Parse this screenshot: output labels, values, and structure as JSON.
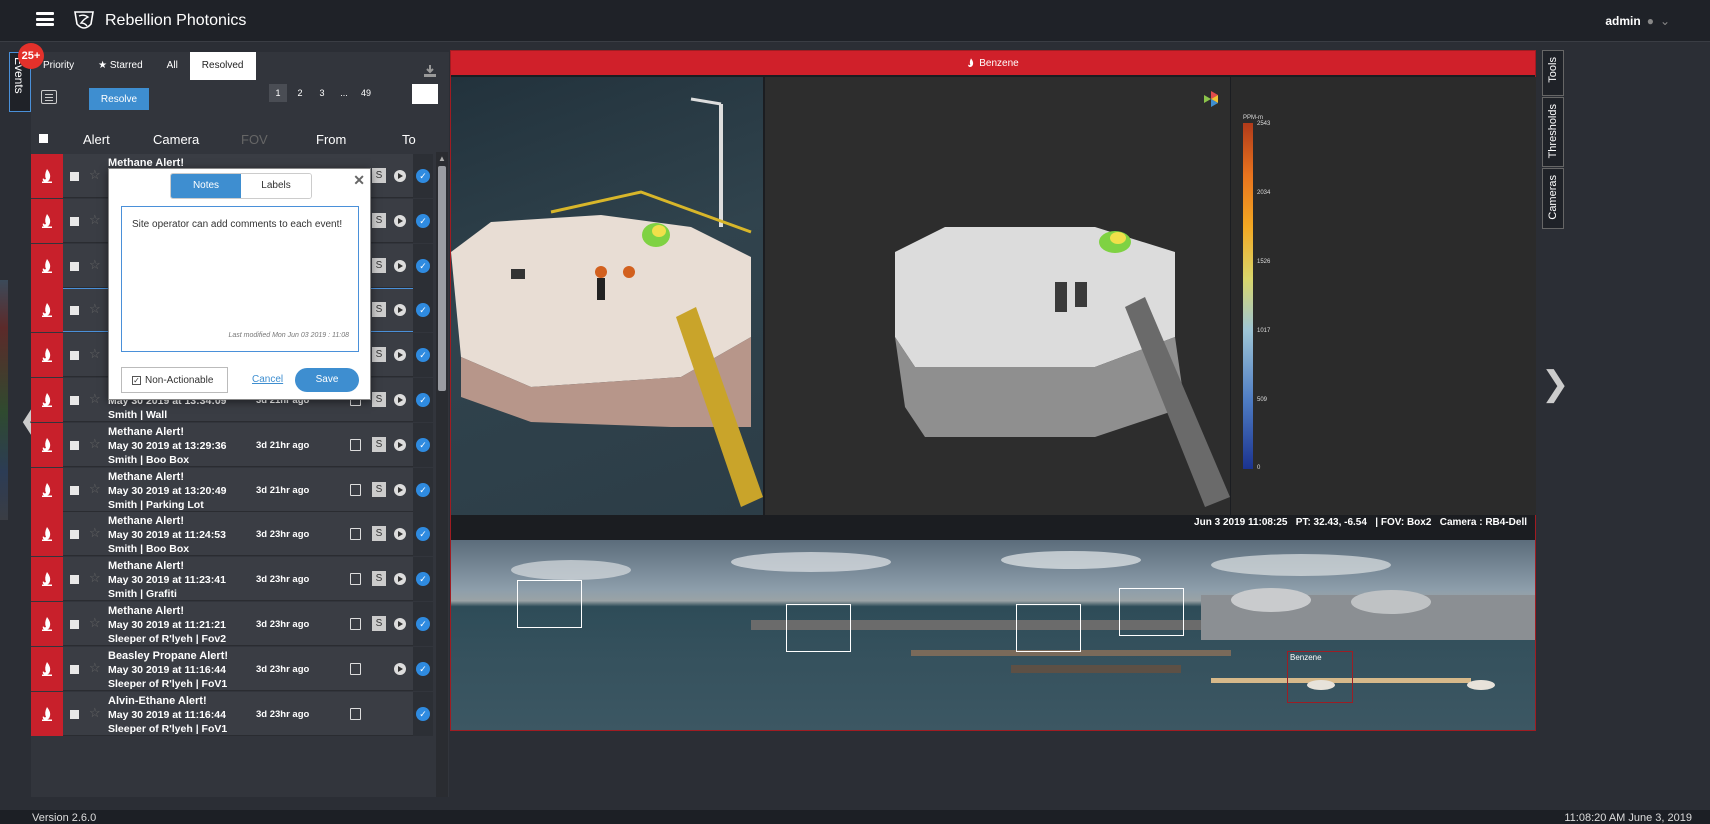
{
  "header": {
    "app_title": "Rebellion Photonics",
    "user": "admin"
  },
  "sidebar": {
    "events_label": "Events",
    "events_badge": "25+"
  },
  "filters": {
    "tabs": [
      "Priority",
      "Starred",
      "All",
      "Resolved"
    ],
    "active_tab": "Resolved"
  },
  "toolbar": {
    "resolve_label": "Resolve"
  },
  "pager": {
    "pages": [
      "1",
      "2",
      "3",
      "...",
      "49"
    ],
    "active_page": "1"
  },
  "list_header": {
    "alert": "Alert",
    "camera": "Camera",
    "fov": "FOV",
    "from": "From",
    "to": "To"
  },
  "events": [
    {
      "title": "Methane Alert!",
      "datetime": "",
      "location": "",
      "ago": "",
      "starred": false,
      "selected": false
    },
    {
      "title": "",
      "datetime": "",
      "location": "",
      "ago": ""
    },
    {
      "title": "",
      "datetime": "",
      "location": "",
      "ago": ""
    },
    {
      "title": "",
      "datetime": "",
      "location": "",
      "ago": "",
      "selected": true
    },
    {
      "title": "",
      "datetime": "",
      "location": "",
      "ago": ""
    },
    {
      "title": "",
      "datetime": "May 30 2019 at 13:34:09",
      "location": "Smith | Wall",
      "ago": "3d 21hr ago"
    },
    {
      "title": "Methane Alert!",
      "datetime": "May 30 2019 at 13:29:36",
      "location": "Smith | Boo Box",
      "ago": "3d 21hr ago"
    },
    {
      "title": "Methane Alert!",
      "datetime": "May 30 2019 at 13:20:49",
      "location": "Smith | Parking Lot",
      "ago": "3d 21hr ago"
    },
    {
      "title": "Methane Alert!",
      "datetime": "May 30 2019 at 11:24:53",
      "location": "Smith | Boo Box",
      "ago": "3d 23hr ago"
    },
    {
      "title": "Methane Alert!",
      "datetime": "May 30 2019 at 11:23:41",
      "location": "Smith | Grafiti",
      "ago": "3d 23hr ago"
    },
    {
      "title": "Methane Alert!",
      "datetime": "May 30 2019 at 11:21:21",
      "location": "Sleeper of R'lyeh | Fov2",
      "ago": "3d 23hr ago"
    },
    {
      "title": "Beasley Propane Alert!",
      "datetime": "May 30 2019 at 11:16:44",
      "location": "Sleeper of R'lyeh | FoV1",
      "ago": "3d 23hr ago"
    },
    {
      "title": "Alvin-Ethane Alert!",
      "datetime": "May 30 2019 at 11:16:44",
      "location": "Sleeper of R'lyeh | FoV1",
      "ago": "3d 23hr ago"
    }
  ],
  "notes_popup": {
    "tabs": [
      "Notes",
      "Labels"
    ],
    "active_tab": "Notes",
    "text": "Site operator can add comments to each event!",
    "last_modified": "Last modified Mon Jun 03 2019 : 11:08",
    "non_actionable_label": "Non-Actionable",
    "non_actionable_checked": true,
    "cancel_label": "Cancel",
    "save_label": "Save"
  },
  "viewer": {
    "alert_label": "Benzene",
    "meta": "Jun 3 2019 11:08:25   PT: 32.43, -6.54   | FOV: Box2   Camera : RB4-Dell",
    "scale_unit": "PPM-m",
    "scale_ticks": [
      "2543",
      "2034",
      "1526",
      "1017",
      "509",
      "0"
    ],
    "pano_detection_label": "Benzene"
  },
  "right_tabs": [
    "Tools",
    "Thresholds",
    "Cameras"
  ],
  "footer": {
    "version": "Version 2.6.0",
    "clock": "11:08:20 AM June 3, 2019"
  },
  "colors": {
    "alert_red": "#d0202a",
    "accent_blue": "#3e8ed0",
    "panel_bg": "#32353c"
  }
}
